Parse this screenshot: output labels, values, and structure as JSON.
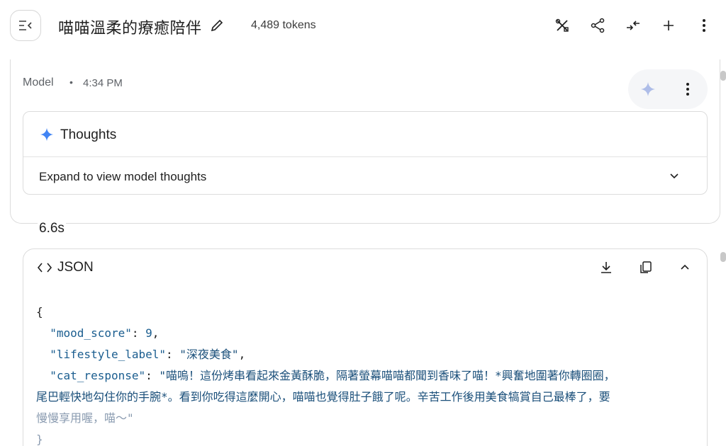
{
  "header": {
    "title": "喵喵溫柔的療癒陪伴",
    "tokens": "4,489 tokens"
  },
  "message": {
    "author": "Model",
    "separator": "•",
    "time": "4:34 PM"
  },
  "thoughts": {
    "title": "Thoughts",
    "expand_label": "Expand to view model thoughts"
  },
  "duration": "6.6s",
  "json_block": {
    "title": "JSON",
    "open_brace": "{",
    "close_brace": "}",
    "mood_key": "\"mood_score\"",
    "mood_value": "9",
    "label_key": "\"lifestyle_label\"",
    "label_value": "\"深夜美食\"",
    "resp_key": "\"cat_response\"",
    "resp_line1": "\"喵嗚！這份烤串看起來金黃酥脆，隔著螢幕喵喵都聞到香味了喵！*興奮地圍著你轉圈圈，",
    "resp_line2": "尾巴輕快地勾住你的手腕*。看到你吃得這麼開心，喵喵也覺得肚子餓了呢。辛苦工作後用美食犒賞自己最棒了，要",
    "resp_line3": "慢慢享用喔，喵～\""
  },
  "colors": {
    "accent_spark": "#4285f4",
    "json_key": "#1a5d8f"
  }
}
